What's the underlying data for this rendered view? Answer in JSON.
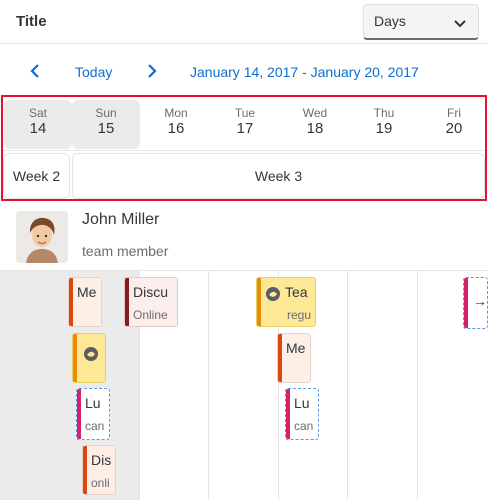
{
  "header": {
    "title": "Title",
    "view_select": "Days"
  },
  "nav": {
    "today": "Today",
    "range": "January 14, 2017 - January 20, 2017"
  },
  "days": [
    {
      "name": "Sat",
      "num": "14"
    },
    {
      "name": "Sun",
      "num": "15"
    },
    {
      "name": "Mon",
      "num": "16"
    },
    {
      "name": "Tue",
      "num": "17"
    },
    {
      "name": "Wed",
      "num": "18"
    },
    {
      "name": "Thu",
      "num": "19"
    },
    {
      "name": "Fri",
      "num": "20"
    }
  ],
  "weeks": {
    "week_a": "Week 2",
    "week_b": "Week 3"
  },
  "person": {
    "name": "John Miller",
    "role": "team member"
  },
  "appointments": {
    "a1": {
      "title": "Me"
    },
    "a2": {
      "title": "Discu",
      "subtitle": "Online"
    },
    "a3": {
      "title": "Tea",
      "subtitle": "regu"
    },
    "a4": {
      "title": "Me"
    },
    "a6": {
      "title": "Lu",
      "subtitle": "can"
    },
    "a7": {
      "title": "Lu",
      "subtitle": "can"
    },
    "a8": {
      "title": "Dis",
      "subtitle": "onli"
    },
    "overflow": "→"
  },
  "colors": {
    "accent": "#0a6ed1",
    "highlight_frame": "#e8102e",
    "weekend_bg": "#ebebeb",
    "orange_bar": "#d9480f",
    "darkred_bar": "#8b1a1a",
    "yellow_bg": "#fde995",
    "pink_bar": "#d6206b"
  }
}
